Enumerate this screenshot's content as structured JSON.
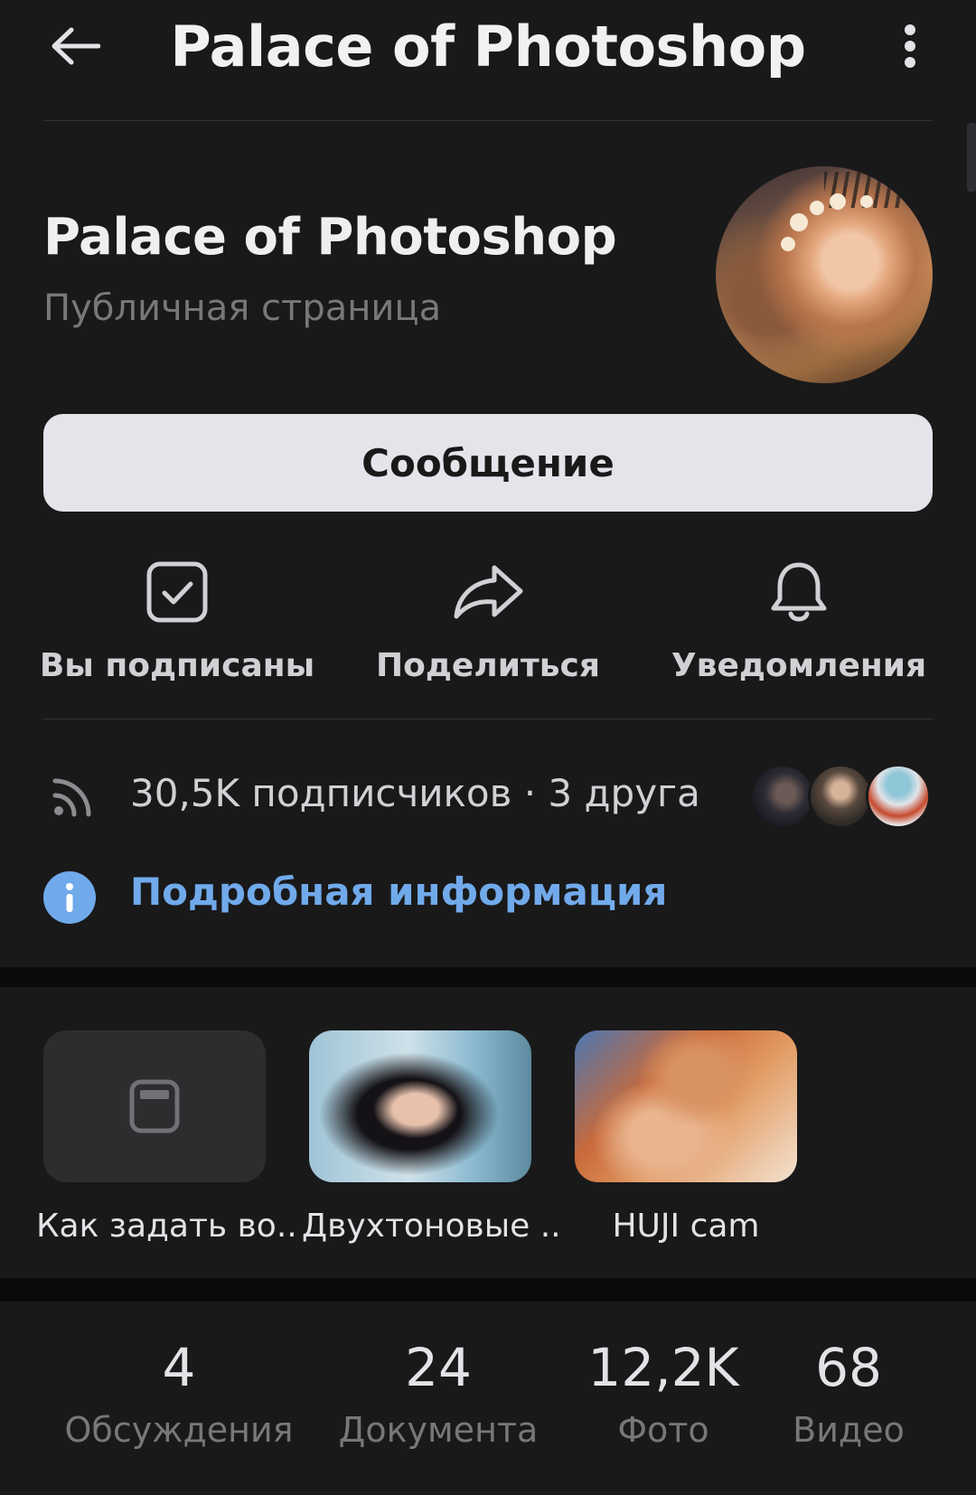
{
  "header": {
    "title": "Palace of Photoshop",
    "back_icon": "arrow-left-icon",
    "more_icon": "more-vertical-icon"
  },
  "profile": {
    "name": "Palace of Photoshop",
    "type": "Публичная страница",
    "message_button": "Сообщение"
  },
  "actions": [
    {
      "label": "Вы подписаны",
      "icon": "checkbox-check-icon"
    },
    {
      "label": "Поделиться",
      "icon": "share-arrow-icon"
    },
    {
      "label": "Уведомления",
      "icon": "bell-icon"
    }
  ],
  "followers": {
    "text": "30,5K подписчиков · 3 друга",
    "icon": "rss-icon"
  },
  "info": {
    "link": "Подробная информация",
    "icon": "info-icon"
  },
  "cards": [
    {
      "label": "Как задать во...",
      "icon": "article-icon"
    },
    {
      "label": "Двухтоновые ...",
      "icon": "photo"
    },
    {
      "label": "HUJI cam",
      "icon": "photo"
    }
  ],
  "counters": [
    {
      "value": "4",
      "caption": "Обсуждения"
    },
    {
      "value": "24",
      "caption": "Документа"
    },
    {
      "value": "12,2K",
      "caption": "Фото"
    },
    {
      "value": "68",
      "caption": "Видео"
    }
  ],
  "colors": {
    "background": "#19191a",
    "accent": "#71aaeb",
    "button": "#e4e5ea",
    "secondary_text": "#76787a"
  }
}
